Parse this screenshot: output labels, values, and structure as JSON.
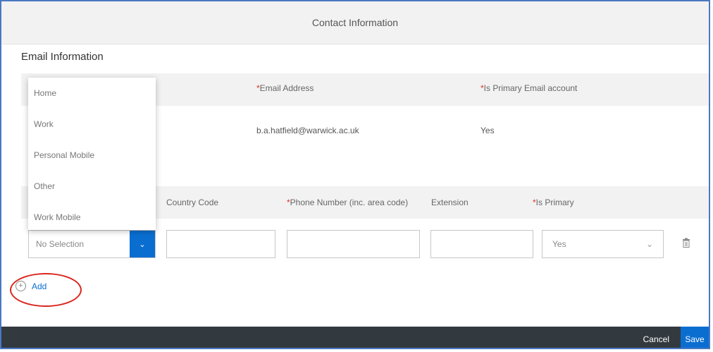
{
  "dialog": {
    "title": "Contact Information"
  },
  "email_section": {
    "title": "Email Information",
    "headers": {
      "address": "Email Address",
      "is_primary": "Is Primary Email account"
    },
    "required_marker": "*",
    "row": {
      "address": "b.a.hatfield@warwick.ac.uk",
      "is_primary": "Yes"
    }
  },
  "phone_section": {
    "headers": {
      "country_code": "Country Code",
      "phone_number": "Phone Number (inc. area code)",
      "extension": "Extension",
      "is_primary": "Is Primary"
    },
    "required_marker": "*",
    "row": {
      "type_value": "No Selection",
      "country_code": "",
      "phone_number": "",
      "extension": "",
      "is_primary": "Yes"
    },
    "type_options": [
      "Home",
      "Work",
      "Personal Mobile",
      "Other",
      "Work Mobile"
    ]
  },
  "add_label": "Add",
  "footer": {
    "cancel": "Cancel",
    "save": "Save"
  },
  "colors": {
    "accent": "#0a6ed1",
    "highlight": "#d9261c",
    "footer_bg": "#333a3f",
    "required": "#e0301e"
  },
  "icons": [
    "chevron-down-icon",
    "trash-icon",
    "add-circle-icon"
  ]
}
